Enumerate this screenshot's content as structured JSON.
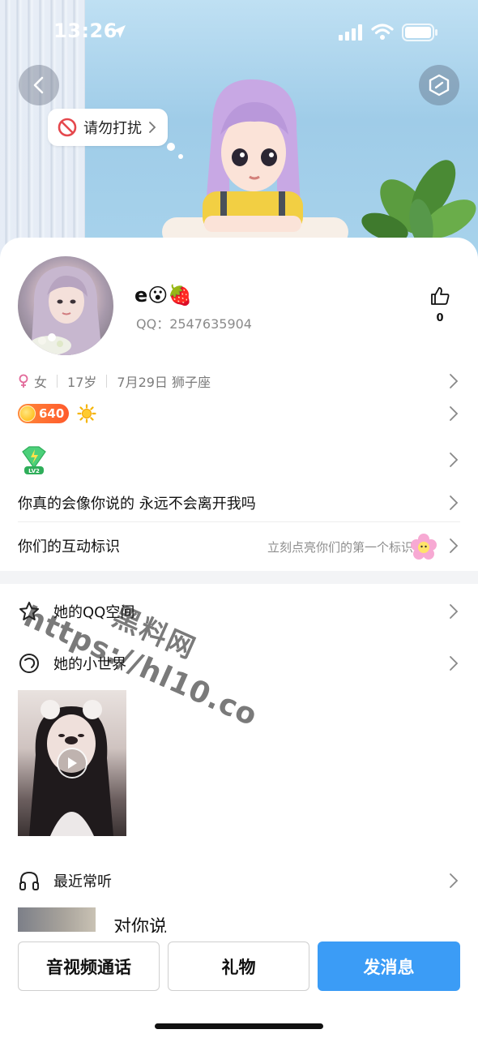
{
  "status_bar": {
    "time": "13:26",
    "icons": [
      "location-arrow-icon",
      "signal-icon",
      "wifi-icon",
      "battery-icon"
    ]
  },
  "header": {
    "back_icon": "chevron-left-icon",
    "action_icon": "hexagon-icon",
    "dnd_label": "请勿打扰",
    "dnd_icon": "no-entry-icon"
  },
  "profile": {
    "nickname": "e😮🍓",
    "qq_id": "QQ：2547635904",
    "like_count": "0",
    "gender": "女",
    "age": "17岁",
    "birthday_zodiac": "7月29日 狮子座",
    "coin_value": "640",
    "vip_level": "LV2",
    "signature": "你真的会像你说的 永远不会离开我吗",
    "interaction_title": "你们的互动标识",
    "interaction_hint": "立刻点亮你们的第一个标识"
  },
  "sections": {
    "qzone": "她的QQ空间",
    "small_world": "她的小世界",
    "recent_music": "最近常听",
    "song_title": "对你说"
  },
  "watermark": {
    "main": "黑料网",
    "url": "https://hl10.co"
  },
  "actions": {
    "call": "音视频通话",
    "gift": "礼物",
    "message": "发消息"
  },
  "colors": {
    "primary_blue": "#3b9cf6",
    "coin_orange": "#ff6a30",
    "gender_pink": "#e26a9a"
  }
}
